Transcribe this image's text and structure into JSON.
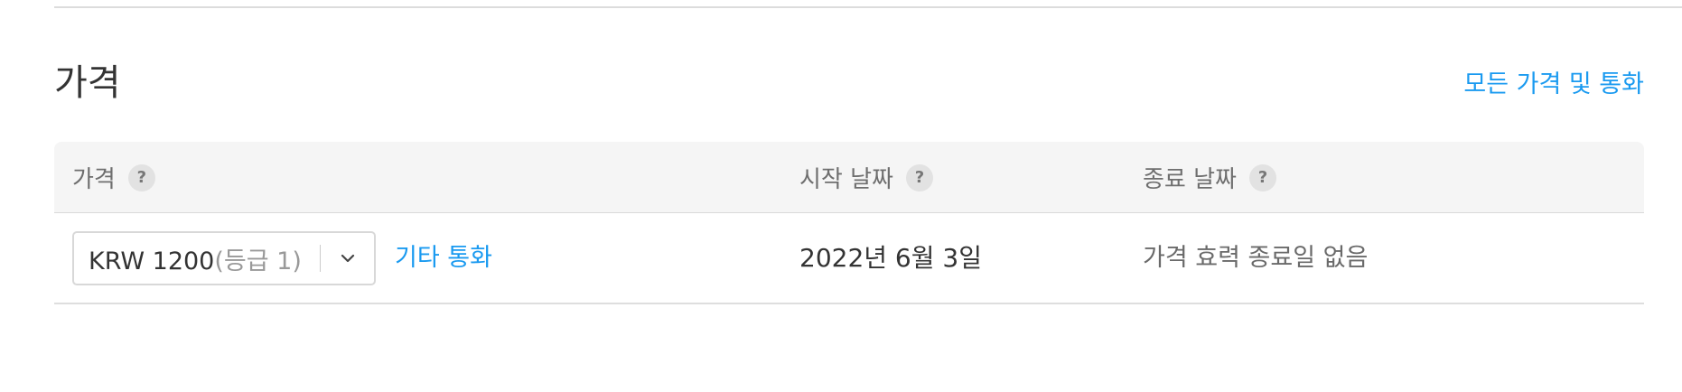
{
  "section": {
    "title": "가격",
    "all_prices_link": "모든 가격 및 통화"
  },
  "table": {
    "columns": {
      "price": "가격",
      "start_date": "시작 날짜",
      "end_date": "종료 날짜"
    },
    "help_glyph": "?",
    "row": {
      "price_value": "KRW 1200",
      "price_tier": "(등급 1)",
      "other_currency_link": "기타 통화",
      "start_date": "2022년 6월 3일",
      "end_date": "가격 효력 종료일 없음"
    }
  },
  "colors": {
    "link": "#1a9af0",
    "header_bg": "#f5f5f5"
  },
  "icons": [
    "help-icon",
    "chevron-down-icon"
  ]
}
